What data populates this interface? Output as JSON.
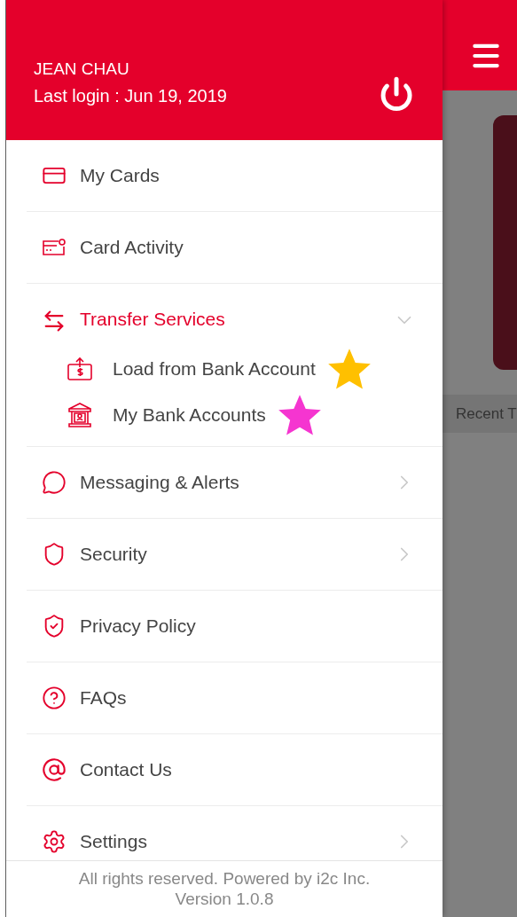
{
  "drawer": {
    "user_name": "JEAN CHAU",
    "last_login": "Last login : Jun 19, 2019",
    "menu": [
      {
        "kind": "link",
        "label": "My Cards",
        "selected": false,
        "chevron": false
      },
      {
        "kind": "link",
        "label": "Card Activity",
        "selected": false,
        "chevron": false
      },
      {
        "kind": "group",
        "label": "Transfer Services",
        "selected": true,
        "expanded": true,
        "children": [
          {
            "label": "Load from Bank Account",
            "color": "#ffc000"
          },
          {
            "label": "My Bank Accounts",
            "color": "#f535d0"
          }
        ]
      },
      {
        "kind": "link",
        "label": "Messaging & Alerts",
        "selected": false,
        "chevron": true
      },
      {
        "kind": "link",
        "label": "Security",
        "selected": false,
        "chevron": true
      },
      {
        "kind": "link",
        "label": "Privacy Policy",
        "selected": false,
        "chevron": false
      },
      {
        "kind": "link",
        "label": "FAQs",
        "selected": false,
        "chevron": false
      },
      {
        "kind": "link",
        "label": "Contact Us",
        "selected": false,
        "chevron": false
      },
      {
        "kind": "link",
        "label": "Settings",
        "selected": false,
        "chevron": true
      }
    ],
    "footer": [
      "All rights reserved. Powered by i2c Inc.",
      "Version 1.0.8"
    ]
  },
  "background": {
    "recent_label": "Recent T"
  }
}
